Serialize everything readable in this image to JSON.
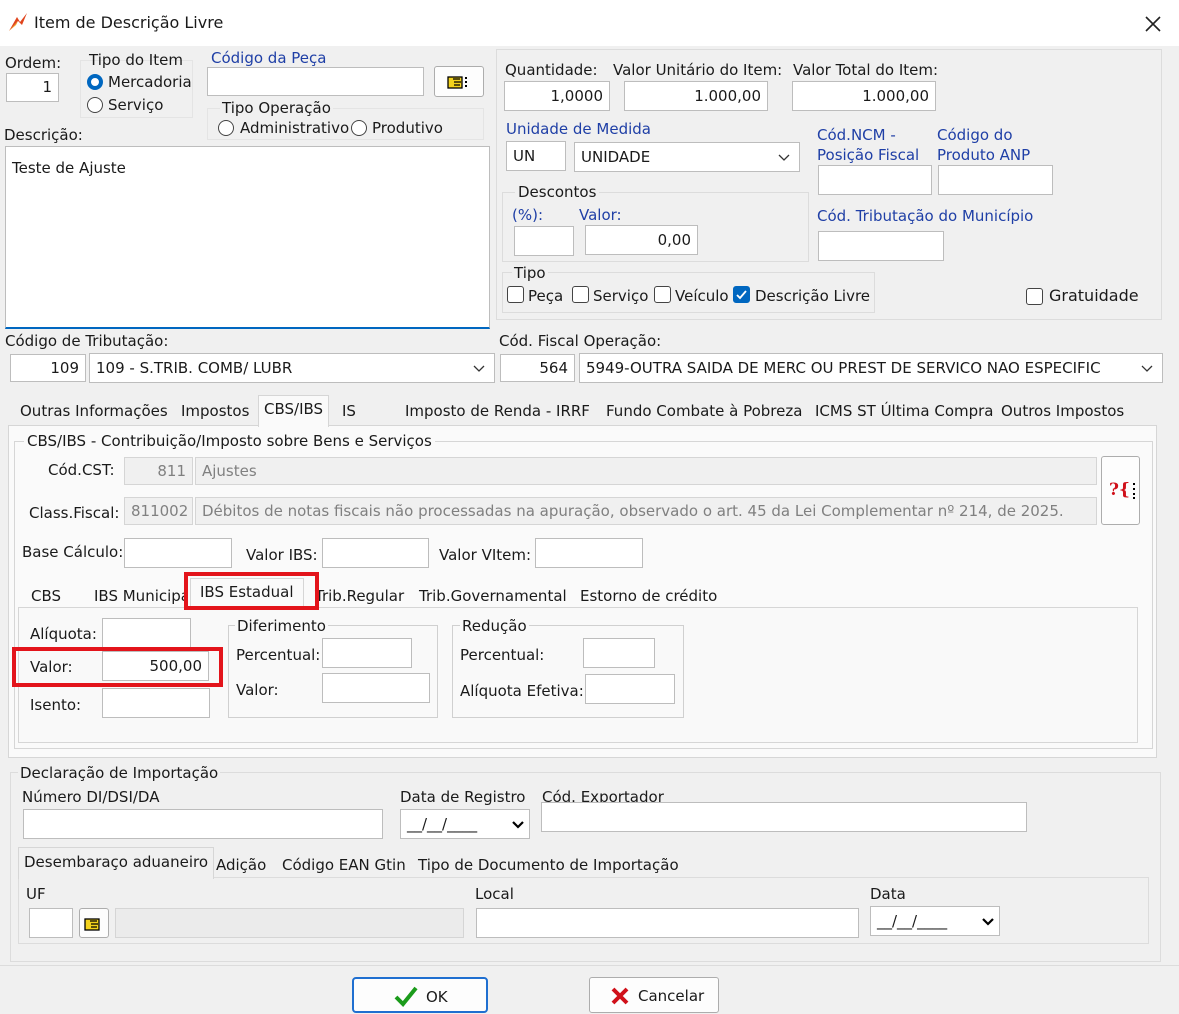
{
  "window": {
    "title": "Item de Descrição Livre"
  },
  "header": {
    "ordem_label": "Ordem:",
    "ordem_value": "1",
    "tipo_item_caption": "Tipo do Item",
    "tipo_item_options": [
      "Mercadoria",
      "Serviço"
    ],
    "codigo_peca_label": "Código da Peça",
    "codigo_peca_value": "",
    "tipo_operacao_caption": "Tipo Operação",
    "tipo_operacao_options": [
      "Administrativo",
      "Produtivo"
    ],
    "descricao_label": "Descrição:",
    "descricao_value": "Teste de Ajuste"
  },
  "values": {
    "quantidade_label": "Quantidade:",
    "quantidade_value": "1,0000",
    "valor_unitario_label": "Valor Unitário do Item:",
    "valor_unitario_value": "1.000,00",
    "valor_total_label": "Valor Total do Item:",
    "valor_total_value": "1.000,00",
    "unidade_label": "Unidade de Medida",
    "unidade_code": "UN",
    "unidade_name": "UNIDADE",
    "ncm_label_1": "Cód.NCM -",
    "ncm_label_2": "Posição Fiscal",
    "anp_label_1": "Código do",
    "anp_label_2": "Produto ANP",
    "descontos_caption": "Descontos",
    "desc_pct_label": "(%):",
    "desc_valor_label": "Valor:",
    "desc_valor_value": "0,00",
    "trib_municipio_label": "Cód. Tributação do Município",
    "tipo_caption": "Tipo",
    "tipo_options": [
      "Peça",
      "Serviço",
      "Veículo",
      "Descrição Livre"
    ],
    "gratuidade_label": "Gratuidade"
  },
  "tributacao": {
    "codigo_trib_label": "Código de Tributação:",
    "codigo_trib_value": "109",
    "codigo_trib_desc": "109 - S.TRIB. COMB/ LUBR",
    "cfop_label": "Cód. Fiscal Operação:",
    "cfop_value": "564",
    "cfop_desc": "5949-OUTRA SAIDA DE MERC OU  PREST DE SERVICO NAO ESPECIFIC"
  },
  "tabs": [
    "Outras Informações",
    "Impostos",
    "CBS/IBS",
    "IS",
    "Imposto de Renda - IRRF",
    "Fundo Combate à Pobreza",
    "ICMS ST Última Compra",
    "Outros Impostos"
  ],
  "cbs_ibs": {
    "group_caption": "CBS/IBS -  Contribuição/Imposto sobre Bens e Serviços",
    "cst_label": "Cód.CST:",
    "cst_code": "811",
    "cst_desc": "Ajustes",
    "class_label": "Class.Fiscal:",
    "class_code": "811002",
    "class_desc": "Débitos de notas fiscais não processadas na apuração, observado o art. 45 da Lei Complementar nº 214, de 2025.",
    "help_button": "?{",
    "base_label": "Base Cálculo:",
    "valor_ibs_label": "Valor IBS:",
    "valor_vitem_label": "Valor VItem:",
    "subtabs": [
      "CBS",
      "IBS Municipal",
      "IBS Estadual",
      "Trib.Regular",
      "Trib.Governamental",
      "Estorno de crédito"
    ],
    "aliquota_label": "Alíquota:",
    "valor_label": "Valor:",
    "valor_value": "500,00",
    "isento_label": "Isento:",
    "diferimento_caption": "Diferimento",
    "dif_percentual_label": "Percentual:",
    "dif_valor_label": "Valor:",
    "reducao_caption": "Redução",
    "red_percentual_label": "Percentual:",
    "red_aliquota_label": "Alíquota Efetiva:"
  },
  "importacao": {
    "caption": "Declaração de Importação",
    "numero_label": "Número DI/DSI/DA",
    "data_registro_label": "Data de Registro",
    "data_registro_value": "__/__/____",
    "exportador_label": "Cód. Exportador",
    "subtabs": [
      "Desembaraço aduaneiro",
      "Adição",
      "Código EAN Gtin",
      "Tipo de Documento de Importação"
    ],
    "uf_label": "UF",
    "local_label": "Local",
    "data_label": "Data",
    "data_value": "__/__/____"
  },
  "footer": {
    "ok_label": "OK",
    "cancel_label": "Cancelar"
  },
  "colors": {
    "accent": "#0067c0",
    "label_blue": "#1f3fa6",
    "highlight_red": "#e3141b"
  }
}
